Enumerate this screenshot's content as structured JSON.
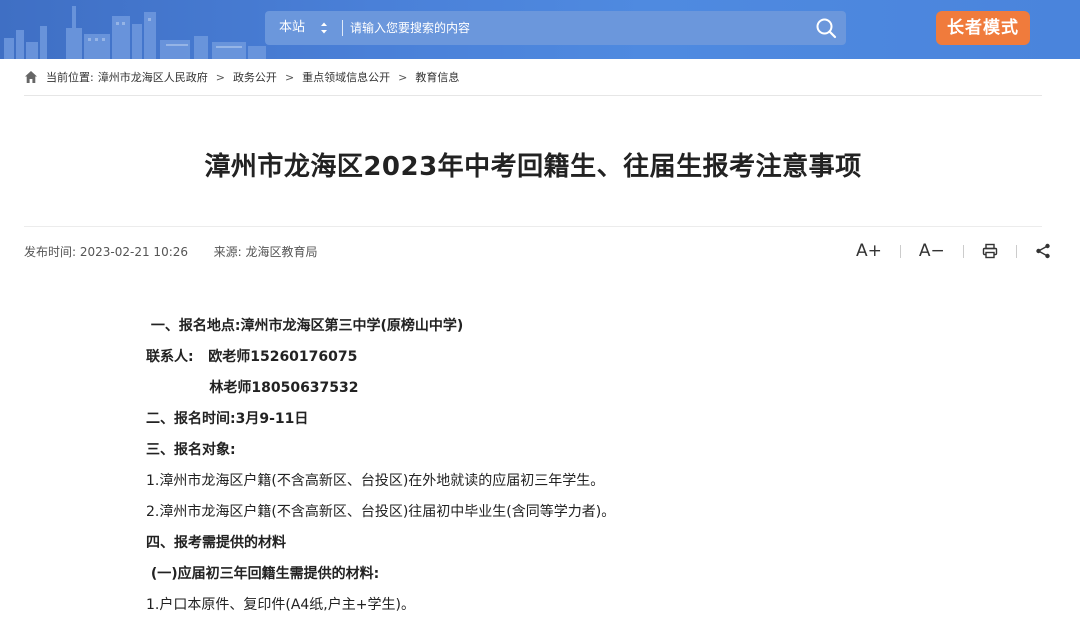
{
  "header": {
    "search_scope": "本站",
    "search_placeholder": "请输入您要搜索的内容",
    "elder_mode_label": "长者模式"
  },
  "breadcrumb": {
    "prefix": "当前位置:",
    "items": [
      "漳州市龙海区人民政府",
      "政务公开",
      "重点领域信息公开",
      "教育信息"
    ],
    "separator": ">"
  },
  "article": {
    "title": "漳州市龙海区2023年中考回籍生、往届生报考注意事项",
    "publish_label": "发布时间:",
    "publish_time": "2023-02-21 10:26",
    "source_label": "来源:",
    "source": "龙海区教育局",
    "tools": {
      "font_larger": "A+",
      "font_smaller": "A−"
    },
    "paragraphs": [
      " 一、报名地点:漳州市龙海区第三中学(原榜山中学)",
      "联系人:   欧老师15260176075",
      "             林老师18050637532",
      "二、报名时间:3月9-11日",
      "三、报名对象:",
      "1.漳州市龙海区户籍(不含高新区、台投区)在外地就读的应届初三年学生。",
      "2.漳州市龙海区户籍(不含高新区、台投区)往届初中毕业生(含同等学力者)。",
      "四、报考需提供的材料",
      " (一)应届初三年回籍生需提供的材料:",
      "1.户口本原件、复印件(A4纸,户主+学生)。"
    ]
  },
  "colors": {
    "header_bg": "#4a80d8",
    "elder_button": "#f07b3c"
  }
}
